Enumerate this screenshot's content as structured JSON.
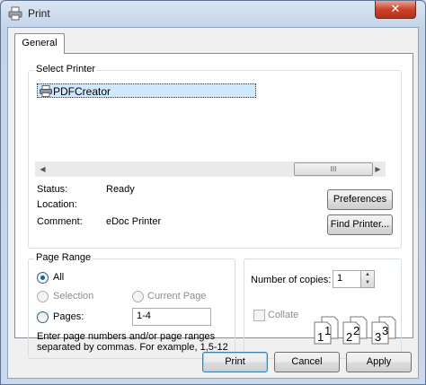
{
  "window": {
    "title": "Print",
    "close_glyph": "✕"
  },
  "tabs": [
    {
      "label": "General"
    }
  ],
  "select_printer": {
    "legend": "Select Printer",
    "printers": [
      {
        "name": "PDFCreator",
        "icon": "printer-icon",
        "selected": true
      }
    ],
    "scrollbar": {
      "left_arrow": "◀",
      "right_arrow": "▶",
      "thumb_grip": "III"
    }
  },
  "printer_info": {
    "status_label": "Status:",
    "status_value": "Ready",
    "location_label": "Location:",
    "location_value": "",
    "comment_label": "Comment:",
    "comment_value": "eDoc Printer",
    "preferences_button": "Preferences",
    "find_printer_button": "Find Printer..."
  },
  "page_range": {
    "legend": "Page Range",
    "options": {
      "all": "All",
      "selection": "Selection",
      "current_page": "Current Page",
      "pages": "Pages:"
    },
    "selected": "all",
    "pages_value": "1-4",
    "hint": "Enter page numbers and/or page ranges separated by commas.  For example, 1,5-12"
  },
  "copies": {
    "label": "Number of copies:",
    "value": "1",
    "collate_label": "Collate",
    "collate_checked": false,
    "collate_pages": [
      "1",
      "1",
      "2",
      "2",
      "3",
      "3"
    ]
  },
  "buttons": {
    "print": "Print",
    "cancel": "Cancel",
    "apply": "Apply"
  }
}
